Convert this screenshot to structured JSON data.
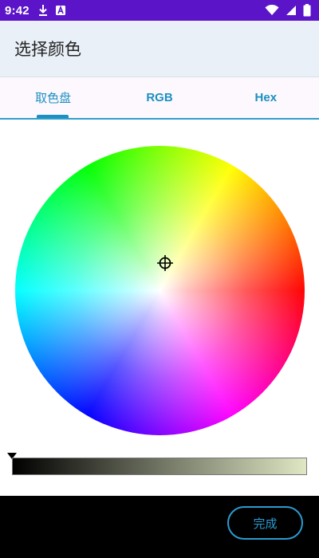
{
  "status_bar": {
    "time": "9:42",
    "icons": [
      "download-icon",
      "a-badge-icon",
      "wifi-icon",
      "signal-icon",
      "battery-icon"
    ]
  },
  "dialog": {
    "title": "选择颜色"
  },
  "tabs": [
    {
      "label": "取色盘",
      "active": true
    },
    {
      "label": "RGB",
      "active": false
    },
    {
      "label": "Hex",
      "active": false
    }
  ],
  "color_picker": {
    "wheel": "hue-saturation-wheel",
    "selector_icon": "crosshair-icon",
    "brightness_gradient": [
      "#000000",
      "#dfe7c4"
    ]
  },
  "actions": {
    "done_label": "完成"
  },
  "colors": {
    "status_bar": "#5b14c8",
    "header_bg": "#e9f0f8",
    "tab_bg": "#fdf8fd",
    "accent": "#1c8fc3",
    "bottom_bar": "#000000"
  }
}
